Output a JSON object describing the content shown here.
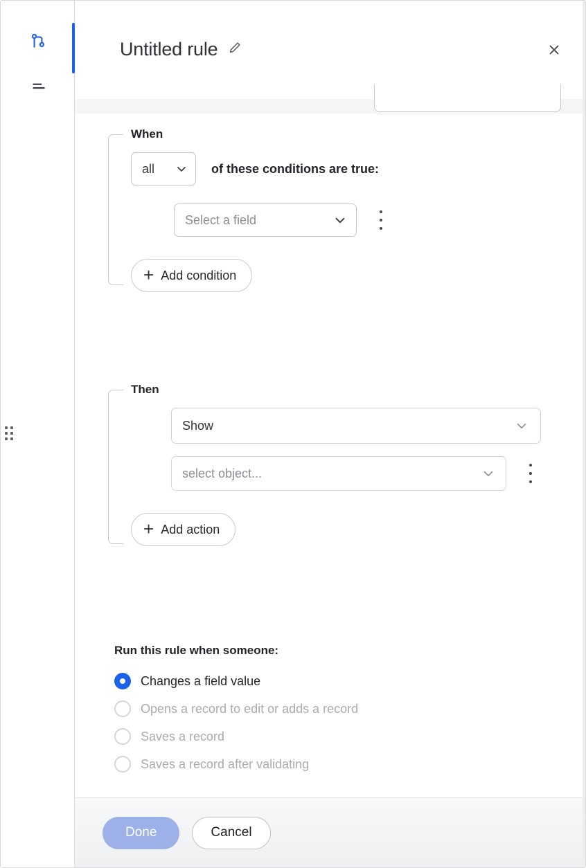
{
  "window": {
    "title": "Untitled rule",
    "edit_icon": "pencil-icon",
    "close_icon": "close-icon"
  },
  "sidebar": {
    "items": [
      {
        "icon": "branch-rule-icon",
        "active": true
      },
      {
        "icon": "menu-list-icon",
        "active": false
      }
    ],
    "drag_handle_icon": "drag-dots-icon",
    "accent_color": "#1a62e8"
  },
  "when_group": {
    "label": "When",
    "match_select": {
      "value": "all",
      "chevron_icon": "chevron-down-icon"
    },
    "conditions_text": "of these conditions are true:",
    "condition_row": {
      "field_select": {
        "placeholder": "Select a field",
        "chevron_icon": "chevron-down-icon"
      },
      "menu_icon": "kebab-menu-icon"
    },
    "add_button": {
      "label": "Add condition",
      "icon": "plus-icon"
    }
  },
  "then_group": {
    "label": "Then",
    "action_select": {
      "value": "Show",
      "chevron_icon": "chevron-down-icon"
    },
    "object_select": {
      "placeholder": "select object...",
      "chevron_icon": "chevron-down-icon"
    },
    "menu_icon": "kebab-menu-icon",
    "add_button": {
      "label": "Add action",
      "icon": "plus-icon"
    }
  },
  "triggers": {
    "heading": "Run this rule when someone:",
    "options": [
      {
        "label": "Changes a field value",
        "selected": true,
        "disabled": false
      },
      {
        "label": "Opens a record to edit or adds a record",
        "selected": false,
        "disabled": true
      },
      {
        "label": "Saves a record",
        "selected": false,
        "disabled": true
      },
      {
        "label": "Saves a record after validating",
        "selected": false,
        "disabled": true
      }
    ]
  },
  "footer": {
    "done_label": "Done",
    "done_disabled": true,
    "cancel_label": "Cancel"
  },
  "colors": {
    "accent_blue": "#1a62e8",
    "done_disabled_blue": "#9db0e8",
    "band_gray": "#f4f5f7",
    "text_primary": "#22242a",
    "text_muted": "#8b8e95"
  }
}
